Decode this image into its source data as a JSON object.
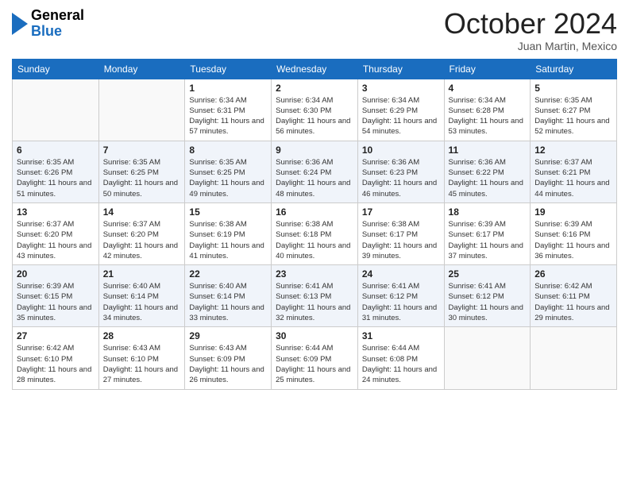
{
  "logo": {
    "general": "General",
    "blue": "Blue"
  },
  "header": {
    "month": "October 2024",
    "location": "Juan Martin, Mexico"
  },
  "days_of_week": [
    "Sunday",
    "Monday",
    "Tuesday",
    "Wednesday",
    "Thursday",
    "Friday",
    "Saturday"
  ],
  "weeks": [
    [
      {
        "day": "",
        "info": ""
      },
      {
        "day": "",
        "info": ""
      },
      {
        "day": "1",
        "info": "Sunrise: 6:34 AM\nSunset: 6:31 PM\nDaylight: 11 hours\nand 57 minutes."
      },
      {
        "day": "2",
        "info": "Sunrise: 6:34 AM\nSunset: 6:30 PM\nDaylight: 11 hours\nand 56 minutes."
      },
      {
        "day": "3",
        "info": "Sunrise: 6:34 AM\nSunset: 6:29 PM\nDaylight: 11 hours\nand 54 minutes."
      },
      {
        "day": "4",
        "info": "Sunrise: 6:34 AM\nSunset: 6:28 PM\nDaylight: 11 hours\nand 53 minutes."
      },
      {
        "day": "5",
        "info": "Sunrise: 6:35 AM\nSunset: 6:27 PM\nDaylight: 11 hours\nand 52 minutes."
      }
    ],
    [
      {
        "day": "6",
        "info": "Sunrise: 6:35 AM\nSunset: 6:26 PM\nDaylight: 11 hours\nand 51 minutes."
      },
      {
        "day": "7",
        "info": "Sunrise: 6:35 AM\nSunset: 6:25 PM\nDaylight: 11 hours\nand 50 minutes."
      },
      {
        "day": "8",
        "info": "Sunrise: 6:35 AM\nSunset: 6:25 PM\nDaylight: 11 hours\nand 49 minutes."
      },
      {
        "day": "9",
        "info": "Sunrise: 6:36 AM\nSunset: 6:24 PM\nDaylight: 11 hours\nand 48 minutes."
      },
      {
        "day": "10",
        "info": "Sunrise: 6:36 AM\nSunset: 6:23 PM\nDaylight: 11 hours\nand 46 minutes."
      },
      {
        "day": "11",
        "info": "Sunrise: 6:36 AM\nSunset: 6:22 PM\nDaylight: 11 hours\nand 45 minutes."
      },
      {
        "day": "12",
        "info": "Sunrise: 6:37 AM\nSunset: 6:21 PM\nDaylight: 11 hours\nand 44 minutes."
      }
    ],
    [
      {
        "day": "13",
        "info": "Sunrise: 6:37 AM\nSunset: 6:20 PM\nDaylight: 11 hours\nand 43 minutes."
      },
      {
        "day": "14",
        "info": "Sunrise: 6:37 AM\nSunset: 6:20 PM\nDaylight: 11 hours\nand 42 minutes."
      },
      {
        "day": "15",
        "info": "Sunrise: 6:38 AM\nSunset: 6:19 PM\nDaylight: 11 hours\nand 41 minutes."
      },
      {
        "day": "16",
        "info": "Sunrise: 6:38 AM\nSunset: 6:18 PM\nDaylight: 11 hours\nand 40 minutes."
      },
      {
        "day": "17",
        "info": "Sunrise: 6:38 AM\nSunset: 6:17 PM\nDaylight: 11 hours\nand 39 minutes."
      },
      {
        "day": "18",
        "info": "Sunrise: 6:39 AM\nSunset: 6:17 PM\nDaylight: 11 hours\nand 37 minutes."
      },
      {
        "day": "19",
        "info": "Sunrise: 6:39 AM\nSunset: 6:16 PM\nDaylight: 11 hours\nand 36 minutes."
      }
    ],
    [
      {
        "day": "20",
        "info": "Sunrise: 6:39 AM\nSunset: 6:15 PM\nDaylight: 11 hours\nand 35 minutes."
      },
      {
        "day": "21",
        "info": "Sunrise: 6:40 AM\nSunset: 6:14 PM\nDaylight: 11 hours\nand 34 minutes."
      },
      {
        "day": "22",
        "info": "Sunrise: 6:40 AM\nSunset: 6:14 PM\nDaylight: 11 hours\nand 33 minutes."
      },
      {
        "day": "23",
        "info": "Sunrise: 6:41 AM\nSunset: 6:13 PM\nDaylight: 11 hours\nand 32 minutes."
      },
      {
        "day": "24",
        "info": "Sunrise: 6:41 AM\nSunset: 6:12 PM\nDaylight: 11 hours\nand 31 minutes."
      },
      {
        "day": "25",
        "info": "Sunrise: 6:41 AM\nSunset: 6:12 PM\nDaylight: 11 hours\nand 30 minutes."
      },
      {
        "day": "26",
        "info": "Sunrise: 6:42 AM\nSunset: 6:11 PM\nDaylight: 11 hours\nand 29 minutes."
      }
    ],
    [
      {
        "day": "27",
        "info": "Sunrise: 6:42 AM\nSunset: 6:10 PM\nDaylight: 11 hours\nand 28 minutes."
      },
      {
        "day": "28",
        "info": "Sunrise: 6:43 AM\nSunset: 6:10 PM\nDaylight: 11 hours\nand 27 minutes."
      },
      {
        "day": "29",
        "info": "Sunrise: 6:43 AM\nSunset: 6:09 PM\nDaylight: 11 hours\nand 26 minutes."
      },
      {
        "day": "30",
        "info": "Sunrise: 6:44 AM\nSunset: 6:09 PM\nDaylight: 11 hours\nand 25 minutes."
      },
      {
        "day": "31",
        "info": "Sunrise: 6:44 AM\nSunset: 6:08 PM\nDaylight: 11 hours\nand 24 minutes."
      },
      {
        "day": "",
        "info": ""
      },
      {
        "day": "",
        "info": ""
      }
    ]
  ]
}
